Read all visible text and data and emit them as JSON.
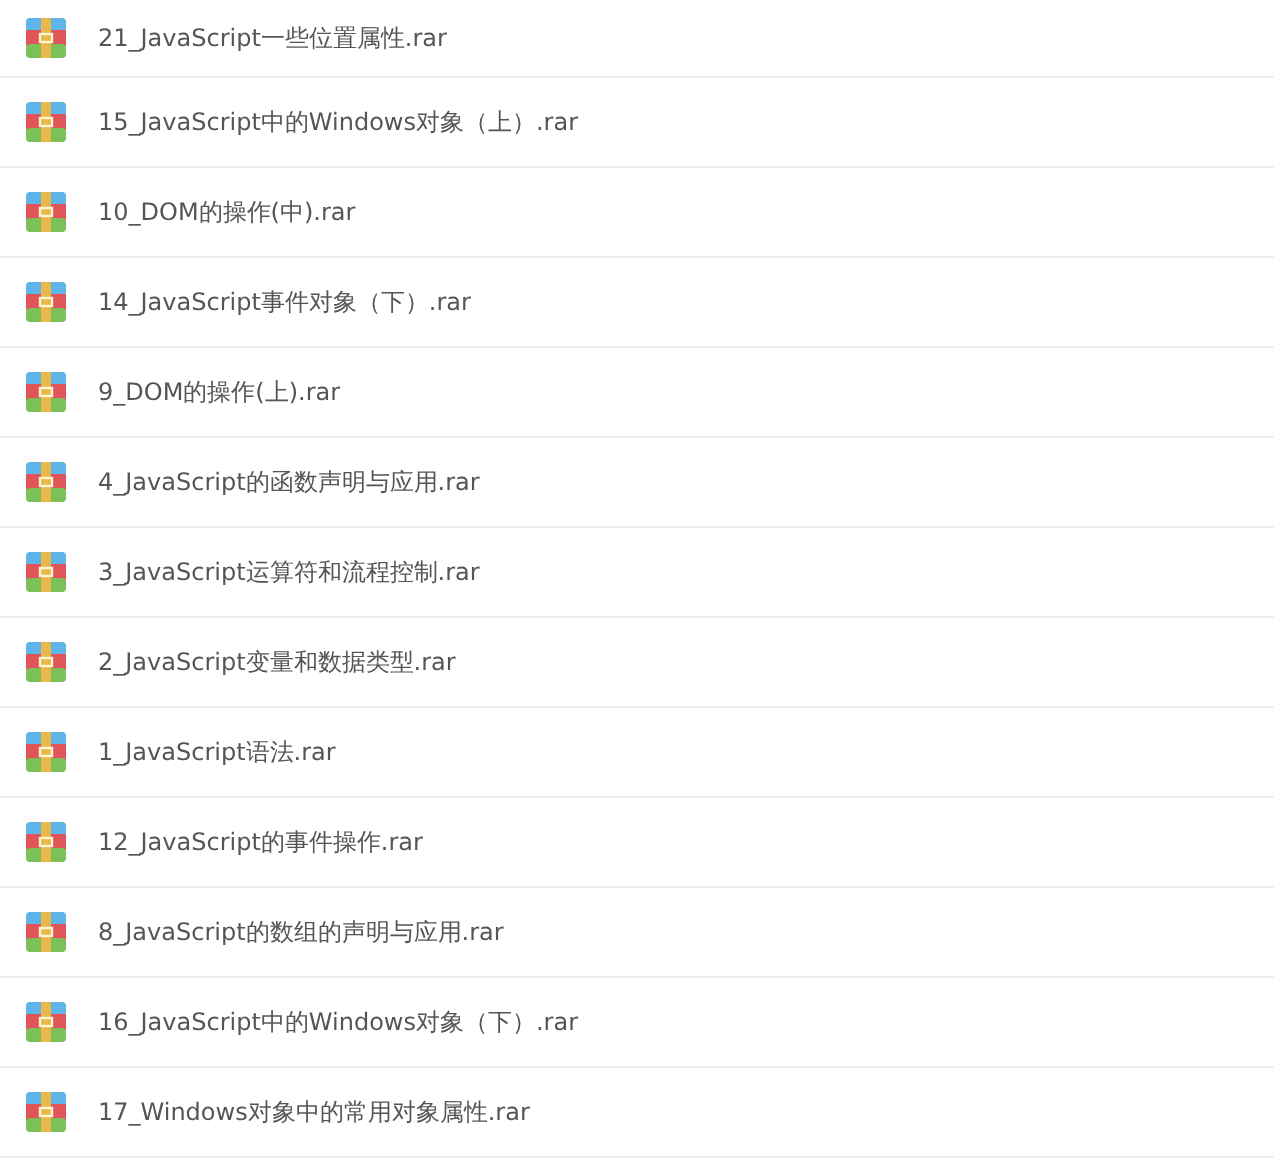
{
  "files": [
    {
      "name": "21_JavaScript一些位置属性.rar"
    },
    {
      "name": "15_JavaScript中的Windows对象（上）.rar"
    },
    {
      "name": "10_DOM的操作(中).rar"
    },
    {
      "name": "14_JavaScript事件对象（下）.rar"
    },
    {
      "name": "9_DOM的操作(上).rar"
    },
    {
      "name": "4_JavaScript的函数声明与应用.rar"
    },
    {
      "name": "3_JavaScript运算符和流程控制.rar"
    },
    {
      "name": "2_JavaScript变量和数据类型.rar"
    },
    {
      "name": "1_JavaScript语法.rar"
    },
    {
      "name": "12_JavaScript的事件操作.rar"
    },
    {
      "name": "8_JavaScript的数组的声明与应用.rar"
    },
    {
      "name": "16_JavaScript中的Windows对象（下）.rar"
    },
    {
      "name": "17_Windows对象中的常用对象属性.rar"
    }
  ]
}
